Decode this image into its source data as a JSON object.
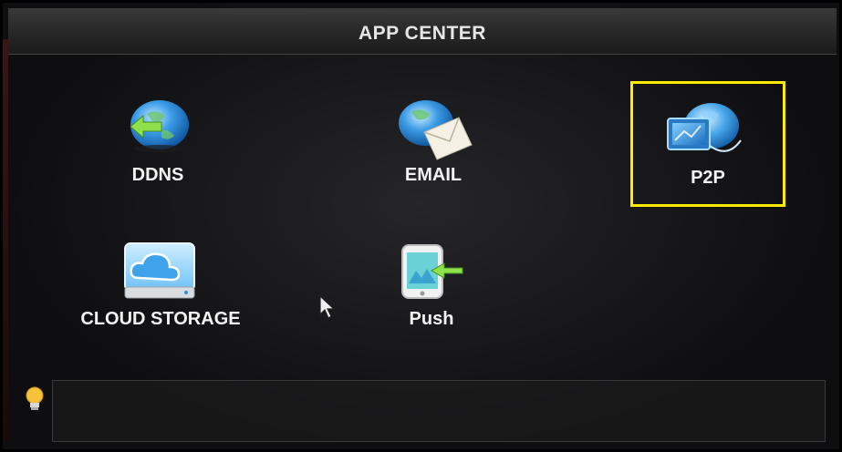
{
  "window": {
    "title": "APP CENTER"
  },
  "apps": [
    {
      "id": "ddns",
      "label": "DDNS",
      "icon": "ddns-globe-icon"
    },
    {
      "id": "email",
      "label": "EMAIL",
      "icon": "email-globe-icon"
    },
    {
      "id": "p2p",
      "label": "P2P",
      "icon": "p2p-monitor-globe-icon",
      "selected": true
    },
    {
      "id": "cloud",
      "label": "CLOUD STORAGE",
      "icon": "cloud-storage-icon"
    },
    {
      "id": "push",
      "label": "Push",
      "icon": "push-phone-icon"
    }
  ],
  "colors": {
    "selection": "#ffeb00",
    "accent_green": "#7fd23a",
    "globe_blue": "#2f8fe0"
  },
  "status": {
    "hint_icon": "lightbulb-icon",
    "text": ""
  },
  "cursor": {
    "icon": "mouse-pointer-icon"
  }
}
